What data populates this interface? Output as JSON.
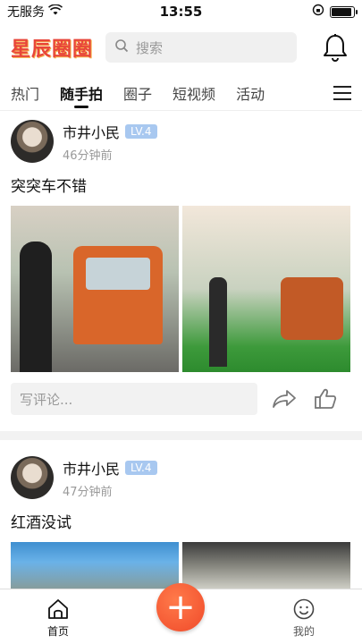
{
  "status_bar": {
    "carrier": "无服务",
    "time": "13:55",
    "battery_level": 0.92
  },
  "header": {
    "logo_text": "星辰圈圈",
    "search_placeholder": "搜索"
  },
  "tabs": [
    {
      "label": "热门",
      "active": false
    },
    {
      "label": "随手拍",
      "active": true
    },
    {
      "label": "圈子",
      "active": false
    },
    {
      "label": "短视频",
      "active": false
    },
    {
      "label": "活动",
      "active": false
    }
  ],
  "posts": [
    {
      "author": "市井小民",
      "level": "LV.4",
      "time": "46分钟前",
      "text": "突突车不错",
      "comment_placeholder": "写评论..."
    },
    {
      "author": "市井小民",
      "level": "LV.4",
      "time": "47分钟前",
      "text": "红酒没试"
    }
  ],
  "bottom_nav": {
    "home_label": "首页",
    "profile_label": "我的",
    "add_label": "+"
  },
  "colors": {
    "accent": "#f04a2a",
    "level_badge": "#a8c8f0",
    "logo": "#e8463a"
  }
}
